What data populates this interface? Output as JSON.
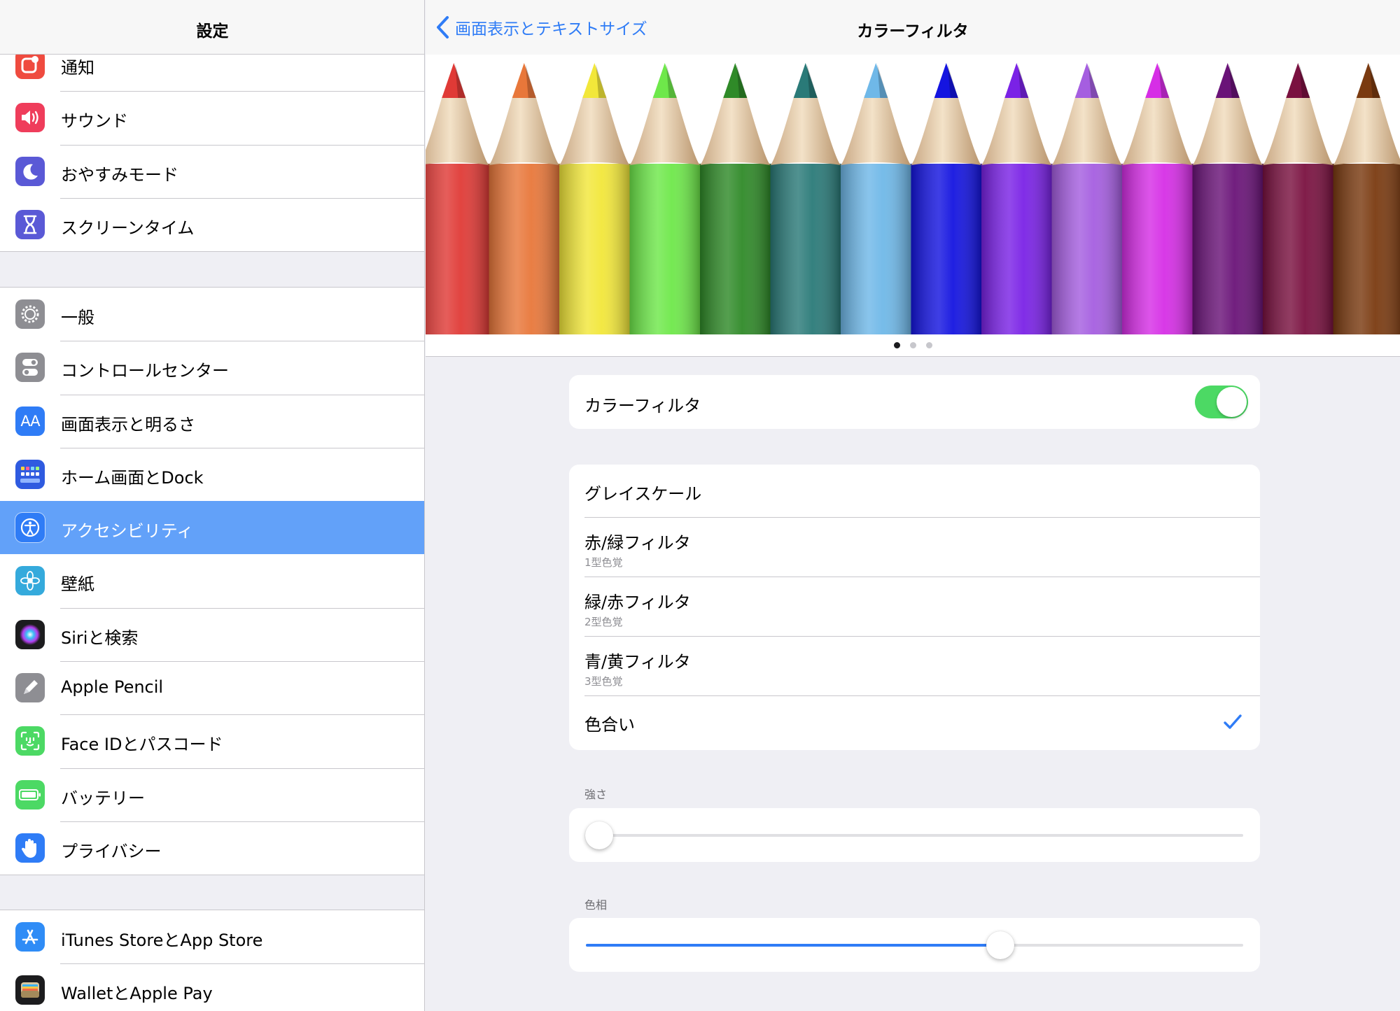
{
  "sidebar": {
    "title": "設定",
    "group1": [
      {
        "label": "通知",
        "icon": "notifications-icon",
        "color": "#ef4b3f"
      },
      {
        "label": "サウンド",
        "icon": "speaker-icon",
        "color": "#ef3d5b"
      },
      {
        "label": "おやすみモード",
        "icon": "moon-icon",
        "color": "#5a59d6"
      },
      {
        "label": "スクリーンタイム",
        "icon": "hourglass-icon",
        "color": "#5a59d6"
      }
    ],
    "group2": [
      {
        "label": "一般",
        "icon": "gear-icon",
        "color": "#8e8e93"
      },
      {
        "label": "コントロールセンター",
        "icon": "switches-icon",
        "color": "#8e8e93"
      },
      {
        "label": "画面表示と明るさ",
        "icon": "display-aa-icon",
        "color": "#2f7cf6"
      },
      {
        "label": "ホーム画面とDock",
        "icon": "home-grid-icon",
        "color": "#2f5be0"
      },
      {
        "label": "アクセシビリティ",
        "icon": "accessibility-icon",
        "color": "#2f7cf6",
        "selected": true
      },
      {
        "label": "壁紙",
        "icon": "flower-icon",
        "color": "#35aadc"
      },
      {
        "label": "Siriと検索",
        "icon": "siri-icon",
        "color": "#1c1c1e"
      },
      {
        "label": "Apple Pencil",
        "icon": "pencil-icon",
        "color": "#8e8e93"
      },
      {
        "label": "Face IDとパスコード",
        "icon": "face-id-icon",
        "color": "#4cd964"
      },
      {
        "label": "バッテリー",
        "icon": "battery-icon",
        "color": "#4cd964"
      },
      {
        "label": "プライバシー",
        "icon": "hand-icon",
        "color": "#2f7cf6"
      }
    ],
    "group3": [
      {
        "label": "iTunes StoreとApp Store",
        "icon": "app-store-icon",
        "color": "#2f8cf6"
      },
      {
        "label": "WalletとApple Pay",
        "icon": "wallet-icon",
        "color": "#1c1c1e"
      }
    ]
  },
  "detail": {
    "back_label": "画面表示とテキストサイズ",
    "title": "カラーフィルタ",
    "pencil_colors": [
      "#e03a36",
      "#e8773a",
      "#f2e73a",
      "#6ee84a",
      "#2f8a28",
      "#2a7a78",
      "#6fb8e8",
      "#1414e0",
      "#7a22e6",
      "#a55ee0",
      "#d62ee6",
      "#6a1378",
      "#7a1140",
      "#7a3a10"
    ],
    "pages": {
      "count": 3,
      "active": 0
    },
    "toggle": {
      "label": "カラーフィルタ",
      "on": true,
      "color": "#4cd964"
    },
    "filters": [
      {
        "label": "グレイスケール",
        "sub": ""
      },
      {
        "label": "赤/緑フィルタ",
        "sub": "1型色覚"
      },
      {
        "label": "緑/赤フィルタ",
        "sub": "2型色覚"
      },
      {
        "label": "青/黄フィルタ",
        "sub": "3型色覚"
      },
      {
        "label": "色合い",
        "sub": "",
        "checked": true
      }
    ],
    "intensity": {
      "label": "強さ",
      "value": 0.02
    },
    "hue": {
      "label": "色相",
      "value": 0.63
    },
    "accent_color": "#2f7cf6"
  }
}
